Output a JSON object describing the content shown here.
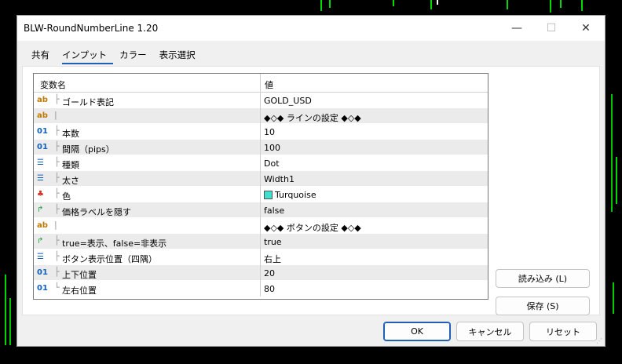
{
  "window": {
    "title": "BLW-RoundNumberLine 1.20",
    "minimize": "—",
    "maximize": "☐",
    "close": "✕"
  },
  "tabs": [
    {
      "label": "共有"
    },
    {
      "label": "インプット",
      "active": true
    },
    {
      "label": "カラー"
    },
    {
      "label": "表示選択"
    }
  ],
  "grid": {
    "col_name": "変数名",
    "col_value": "値",
    "rows": [
      {
        "icon": "ab",
        "icon_name": "string-icon",
        "tree": "├",
        "name": "ゴールド表記",
        "value": "GOLD_USD"
      },
      {
        "icon": "ab",
        "icon_name": "string-icon",
        "tree": "|",
        "name": "",
        "value": "◆◇◆ ラインの設定 ◆◇◆"
      },
      {
        "icon": "01",
        "icon_name": "integer-icon",
        "tree": "├",
        "name": "本数",
        "value": "10"
      },
      {
        "icon": "01",
        "icon_name": "integer-icon",
        "tree": "├",
        "name": "間隔（pips）",
        "value": "100"
      },
      {
        "icon": "☰",
        "icon_name": "enum-icon",
        "tree": "├",
        "name": "種類",
        "value": "Dot"
      },
      {
        "icon": "☰",
        "icon_name": "enum-icon",
        "tree": "├",
        "name": "太さ",
        "value": "Width1"
      },
      {
        "icon": "♣",
        "icon_name": "color-icon",
        "tree": "├",
        "name": "色",
        "value": "Turquoise",
        "swatch": "#40e0d0"
      },
      {
        "icon": "↱",
        "icon_name": "bool-icon",
        "tree": "├",
        "name": "価格ラベルを隠す",
        "value": "false"
      },
      {
        "icon": "ab",
        "icon_name": "string-icon",
        "tree": "|",
        "name": "",
        "value": "◆◇◆ ボタンの設定 ◆◇◆"
      },
      {
        "icon": "↱",
        "icon_name": "bool-icon",
        "tree": "├",
        "name": "true=表示、false=非表示",
        "value": "true"
      },
      {
        "icon": "☰",
        "icon_name": "enum-icon",
        "tree": "├",
        "name": "ボタン表示位置（四隅）",
        "value": "右上"
      },
      {
        "icon": "01",
        "icon_name": "integer-icon",
        "tree": "├",
        "name": "上下位置",
        "value": "20"
      },
      {
        "icon": "01",
        "icon_name": "integer-icon",
        "tree": "└",
        "name": "左右位置",
        "value": "80"
      }
    ]
  },
  "side_buttons": {
    "load": "読み込み (L)",
    "save": "保存 (S)"
  },
  "footer": {
    "ok": "OK",
    "cancel": "キャンセル",
    "reset": "リセット"
  }
}
